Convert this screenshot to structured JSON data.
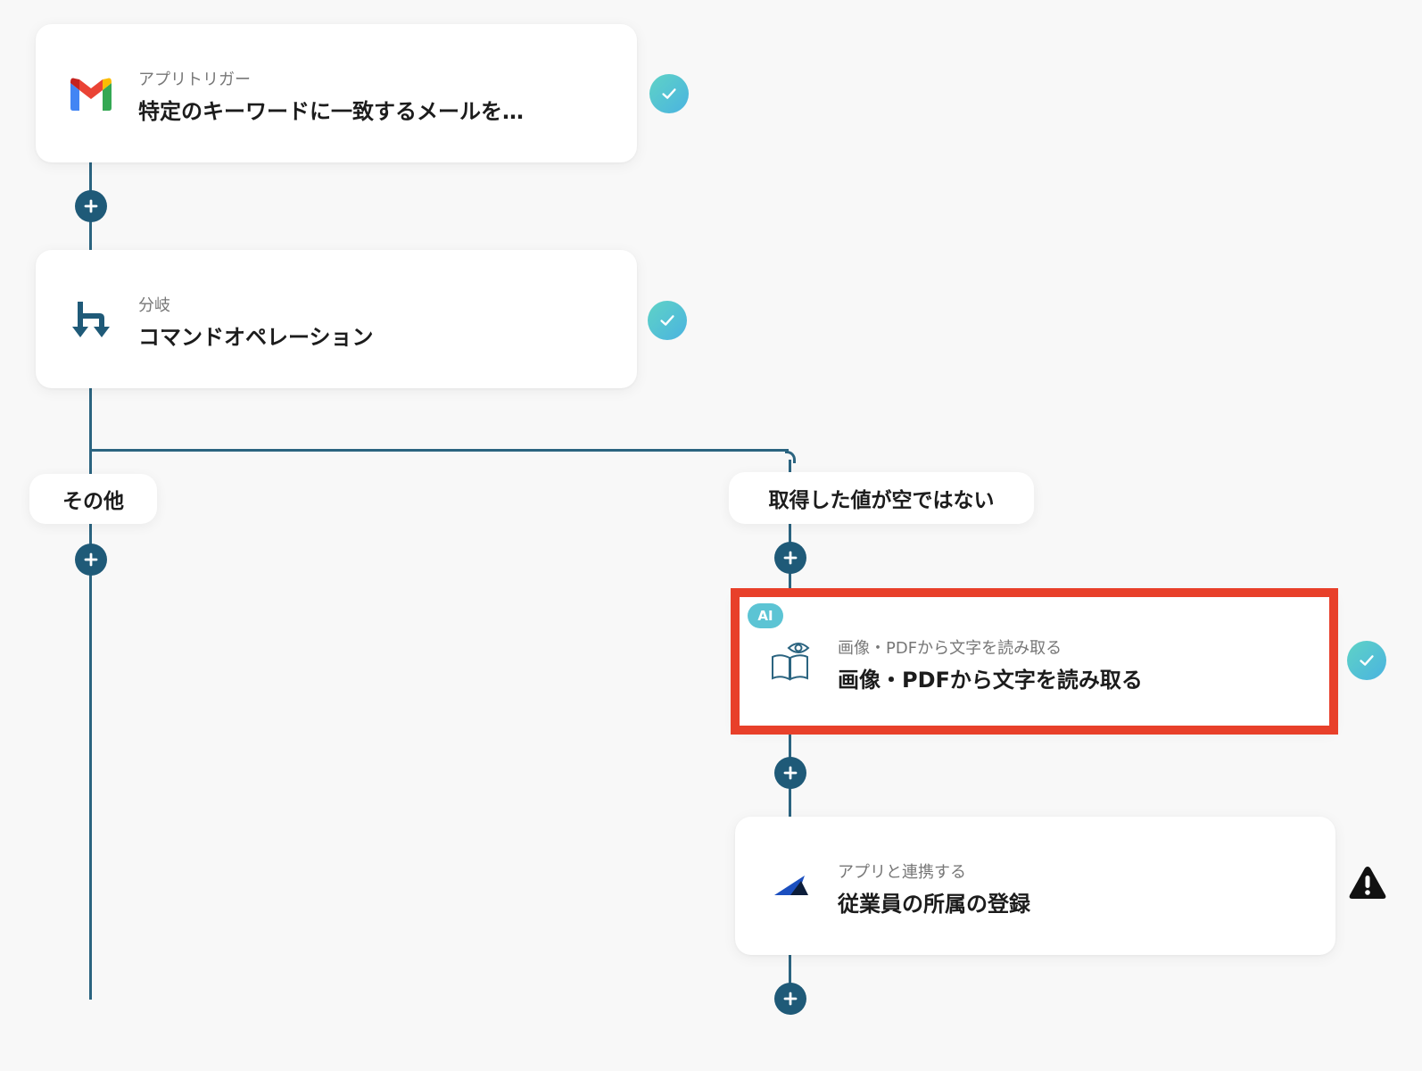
{
  "steps": {
    "trigger": {
      "sub": "アプリトリガー",
      "title": "特定のキーワードに一致するメールを…",
      "icon": "gmail-icon"
    },
    "branch": {
      "sub": "分岐",
      "title": "コマンドオペレーション",
      "icon": "branch-icon"
    },
    "ocr": {
      "badge": "AI",
      "sub": "画像・PDFから文字を読み取る",
      "title": "画像・PDFから文字を読み取る",
      "icon": "book-eye-icon"
    },
    "register": {
      "sub": "アプリと連携する",
      "title": "従業員の所属の登録",
      "icon": "triangle-logo-icon"
    }
  },
  "branches": {
    "left": {
      "label": "その他"
    },
    "right": {
      "label": "取得した値が空ではない"
    }
  },
  "colors": {
    "connector": "#2b6480",
    "plus": "#1f5a78",
    "check_gradient": [
      "#5fd3c6",
      "#4ab3e0"
    ],
    "highlight": "#e8402a",
    "ai_badge": "#5cc4d4"
  }
}
